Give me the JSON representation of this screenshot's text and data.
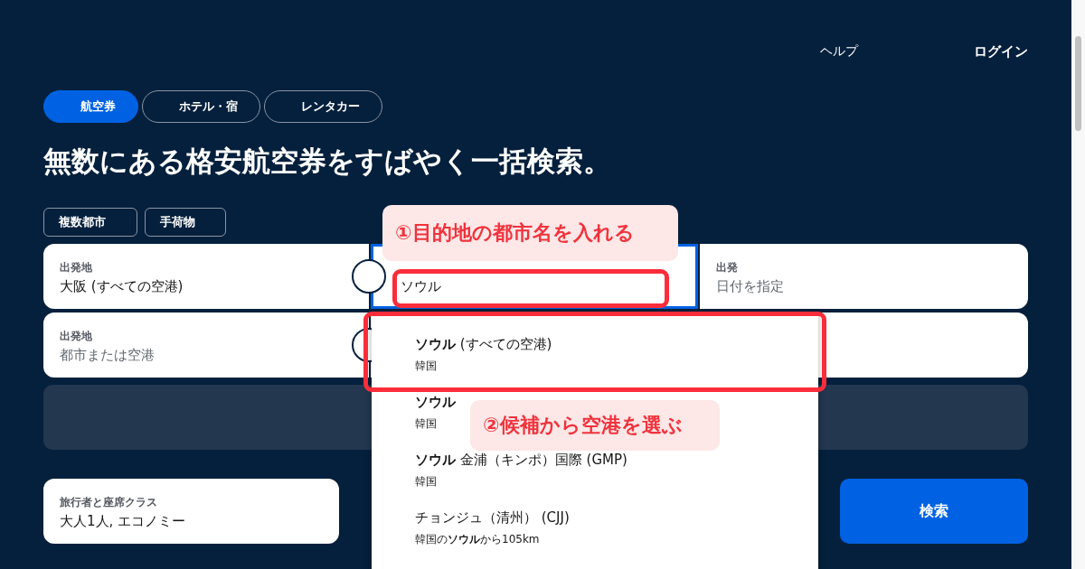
{
  "header": {
    "links": [
      {
        "label": "ヘルプ",
        "kind": "plain"
      },
      {
        "label": "ログイン",
        "kind": "bold"
      }
    ]
  },
  "tabs": [
    {
      "label": "航空券",
      "selected": true
    },
    {
      "label": "ホテル・宿",
      "selected": false
    },
    {
      "label": "レンタカー",
      "selected": false
    }
  ],
  "headline": "無数にある格安航空券をすばやく一括検索。",
  "options": [
    "複数都市",
    "手荷物"
  ],
  "legs": [
    {
      "fields": [
        {
          "label": "出発地",
          "value": "大阪 (すべての空港)",
          "focused": false
        },
        {
          "value": "ソウル",
          "focused": true
        },
        {
          "label": "出発",
          "placeholder": "日付を指定",
          "focused": false
        }
      ]
    },
    {
      "fields": [
        {
          "label": "出発地",
          "placeholder": "都市または空港",
          "focused": false
        },
        {
          "focused": false
        },
        {
          "focused": false
        }
      ]
    }
  ],
  "travelers": {
    "label": "旅行者と座席クラス",
    "value": "大人1人, エコノミー"
  },
  "search_button": "検索",
  "suggestions": [
    {
      "name": "**ソウル** (すべての空港)",
      "detail": "韓国"
    },
    {
      "name": "**ソウル**",
      "detail": "韓国"
    },
    {
      "name": "**ソウル** 金浦（キンポ）国際 (GMP)",
      "detail": "韓国"
    },
    {
      "name": "チョンジュ（清州） (CJJ)",
      "detail": "韓国の**ソウル**から105km"
    }
  ],
  "annotations": [
    {
      "text": "①目的地の都市名を入れる"
    },
    {
      "text": "②候補から空港を選ぶ"
    }
  ]
}
